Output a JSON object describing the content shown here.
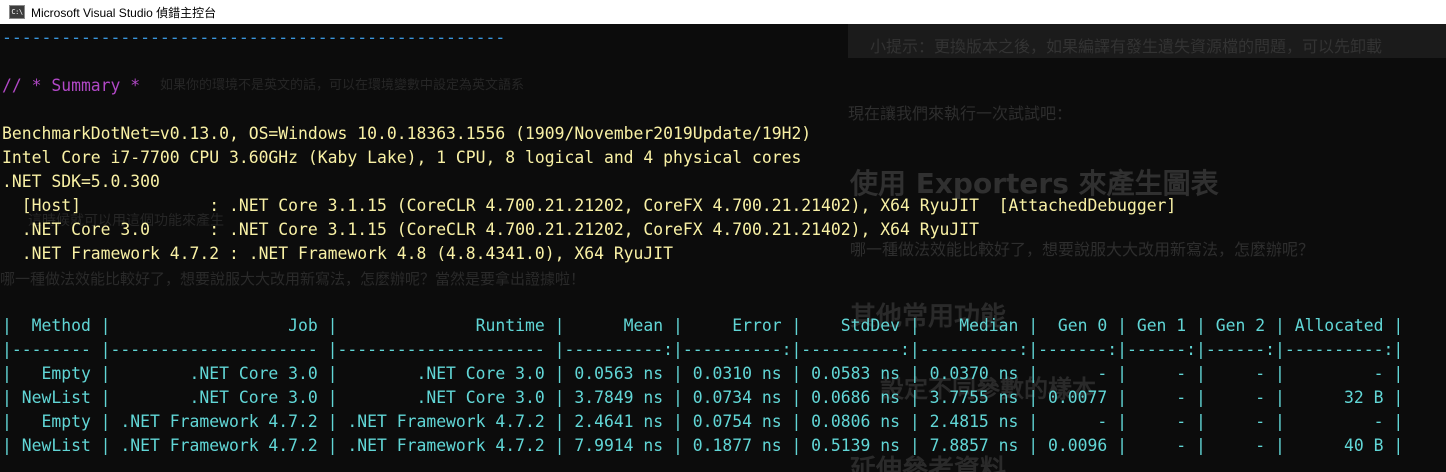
{
  "window": {
    "title": "Microsoft Visual Studio 偵錯主控台",
    "icon_label": "C:\\"
  },
  "console": {
    "separator": "---------------------------------------------------",
    "summary_header": "// * Summary *",
    "env_lines": [
      "BenchmarkDotNet=v0.13.0, OS=Windows 10.0.18363.1556 (1909/November2019Update/19H2)",
      "Intel Core i7-7700 CPU 3.60GHz (Kaby Lake), 1 CPU, 8 logical and 4 physical cores",
      ".NET SDK=5.0.300",
      "  [Host]             : .NET Core 3.1.15 (CoreCLR 4.700.21.21202, CoreFX 4.700.21.21402), X64 RyuJIT  [AttachedDebugger]",
      "  .NET Core 3.0      : .NET Core 3.1.15 (CoreCLR 4.700.21.21202, CoreFX 4.700.21.21402), X64 RyuJIT",
      "  .NET Framework 4.7.2 : .NET Framework 4.8 (4.8.4341.0), X64 RyuJIT"
    ],
    "table_lines": [
      "|  Method |                  Job |              Runtime |      Mean |     Error |    StdDev |    Median |  Gen 0 | Gen 1 | Gen 2 | Allocated |",
      "|-------- |--------------------- |--------------------- |----------:|----------:|----------:|----------:|-------:|------:|------:|----------:|",
      "|   Empty |        .NET Core 3.0 |        .NET Core 3.0 | 0.0563 ns | 0.0310 ns | 0.0583 ns | 0.0370 ns |      - |     - |     - |         - |",
      "| NewList |        .NET Core 3.0 |        .NET Core 3.0 | 3.7849 ns | 0.0734 ns | 0.0686 ns | 3.7755 ns | 0.0077 |     - |     - |      32 B |",
      "|   Empty | .NET Framework 4.7.2 | .NET Framework 4.7.2 | 2.4641 ns | 0.0754 ns | 0.0806 ns | 2.4815 ns |      - |     - |     - |         - |",
      "| NewList | .NET Framework 4.7.2 | .NET Framework 4.7.2 | 7.9914 ns | 0.1877 ns | 0.5139 ns | 7.8857 ns | 0.0096 |     - |     - |      40 B |"
    ]
  },
  "background": {
    "tip": "小提示：更換版本之後，如果編譯有發生遺失資源檔的問題，可以先卸載",
    "line1": "如果你的環境不是英文的話，可以在環境變數中設定為英文語系",
    "run_now": "現在讓我們來執行一次試試吧：",
    "heading_exporters": "使用 Exporters 來產生圖表",
    "para_which": "哪一種做法效能比較好了，想要說服大大改用新寫法，怎麼辦呢？",
    "heading_other": "其他常用功能",
    "heading_sample": "設定不同參數的樣本",
    "heading_refs": "延伸參考資料",
    "left_small": "這時候就可以用這個功能來產生",
    "left_line": "哪一種做法效能比較好了，想要說服大大改用新寫法，怎麼辦呢？當然是要拿出證據啦！"
  },
  "colors": {
    "separator": "#3a96dd",
    "summary": "#b148c6",
    "environment": "#f9f1a5",
    "table": "#61d6d6",
    "background": "#0c0c0c",
    "titlebar": "#ffffff"
  }
}
